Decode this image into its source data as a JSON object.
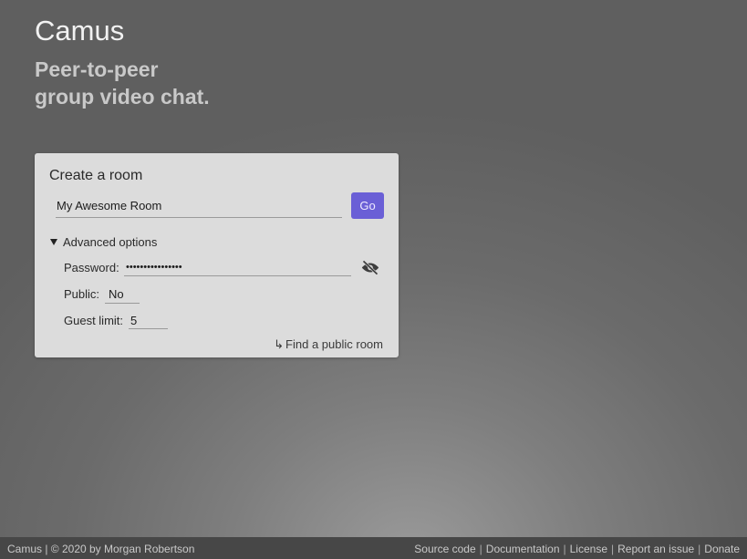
{
  "hero": {
    "title": "Camus",
    "subtitle_line1": "Peer-to-peer",
    "subtitle_line2": "group video chat."
  },
  "create_room": {
    "title": "Create a room",
    "room_name_value": "My Awesome Room",
    "go_label": "Go",
    "advanced_label": "Advanced options",
    "password_label": "Password:",
    "password_value": "••••••••••••••••",
    "public_label": "Public:",
    "public_value": "No",
    "guest_limit_label": "Guest limit:",
    "guest_limit_value": "5",
    "find_public_label": "Find a public room",
    "find_public_arrow": "↳",
    "accent_color": "#6a5fd6",
    "icons": {
      "advanced_toggle": "triangle-down-icon",
      "password_visibility": "eye-slash-icon"
    }
  },
  "footer": {
    "left_text": "Camus | © 2020 by Morgan Robertson",
    "links": {
      "source_code": "Source code",
      "documentation": "Documentation",
      "license": "License",
      "report_issue": "Report an issue",
      "donate": "Donate"
    },
    "separator": "|"
  }
}
